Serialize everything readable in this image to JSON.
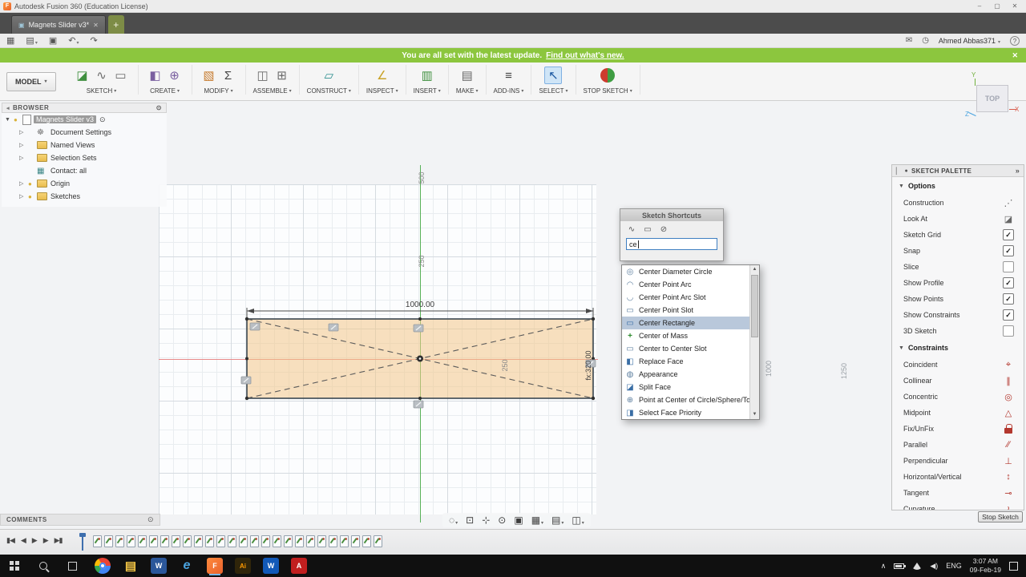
{
  "colors": {
    "banner_green": "#8cc63e",
    "highlight_blue": "#b9c8db",
    "sketch_fill": "#f2c789",
    "axis_green": "#58b158",
    "axis_red": "#e98a8a",
    "fusion_orange": "#e8622d"
  },
  "titlebar": {
    "app_badge": "F",
    "title": "Autodesk Fusion 360 (Education License)",
    "minimize": "–",
    "maximize": "▢",
    "close": "✕"
  },
  "tabs": {
    "icon": "▣",
    "active_label": "Magnets Slider v3*",
    "active_close": "✕",
    "new_tab": "+"
  },
  "quickbar": {
    "icons": [
      {
        "name": "app-launcher-icon",
        "glyph": "▦",
        "caret": ""
      },
      {
        "name": "file-menu-icon",
        "glyph": "▤",
        "caret": "▾"
      },
      {
        "name": "save-icon",
        "glyph": "▣",
        "caret": ""
      },
      {
        "name": "undo-icon",
        "glyph": "↶",
        "caret": "▾"
      },
      {
        "name": "redo-icon",
        "glyph": "↷",
        "caret": ""
      }
    ],
    "comment_icon": "✉",
    "history_icon": "◷",
    "user_name": "Ahmed Abbas371",
    "user_caret": "▾",
    "help": "?"
  },
  "banner": {
    "message": "You are all set with the latest update.",
    "link": "Find out what's new.",
    "close": "✕"
  },
  "ribbon": {
    "workspace": "MODEL",
    "caret": "▾",
    "groups": [
      {
        "label": "SKETCH",
        "icons": [
          {
            "name": "create-sketch-icon",
            "glyph": "◪",
            "cls": "ic-green"
          },
          {
            "name": "spline-icon",
            "glyph": "∿",
            "cls": "ic-gray"
          },
          {
            "name": "sketch-rectangle-icon",
            "glyph": "▭",
            "cls": "ic-gray"
          }
        ]
      },
      {
        "label": "CREATE",
        "icons": [
          {
            "name": "create-form-icon",
            "glyph": "◧",
            "cls": "ic-purple"
          },
          {
            "name": "create-primitive-icon",
            "glyph": "⊕",
            "cls": "ic-purple"
          }
        ]
      },
      {
        "label": "MODIFY",
        "icons": [
          {
            "name": "press-pull-icon",
            "glyph": "▧",
            "cls": "ic-orange"
          },
          {
            "name": "change-parameters-icon",
            "glyph": "Σ",
            "cls": "ic-dark"
          }
        ]
      },
      {
        "label": "ASSEMBLE",
        "icons": [
          {
            "name": "new-component-icon",
            "glyph": "◫",
            "cls": "ic-gray"
          },
          {
            "name": "joint-icon",
            "glyph": "⊞",
            "cls": "ic-gray"
          }
        ]
      },
      {
        "label": "CONSTRUCT",
        "icons": [
          {
            "name": "construction-plane-icon",
            "glyph": "▱",
            "cls": "ic-teal"
          }
        ]
      },
      {
        "label": "INSPECT",
        "icons": [
          {
            "name": "measure-icon",
            "glyph": "∠",
            "cls": "ic-yellow"
          }
        ]
      },
      {
        "label": "INSERT",
        "icons": [
          {
            "name": "insert-icon",
            "glyph": "▥",
            "cls": "ic-green"
          }
        ]
      },
      {
        "label": "MAKE",
        "icons": [
          {
            "name": "make-icon",
            "glyph": "▤",
            "cls": "ic-gray"
          }
        ]
      },
      {
        "label": "ADD-INS",
        "icons": [
          {
            "name": "add-ins-icon",
            "glyph": "≡",
            "cls": "ic-dark"
          }
        ]
      },
      {
        "label": "SELECT",
        "active": true,
        "icons": [
          {
            "name": "select-icon",
            "glyph": "↖",
            "cls": "ic-select"
          }
        ]
      },
      {
        "label": "STOP SKETCH",
        "icons": [
          {
            "name": "stop-sketch-icon",
            "glyph": "●",
            "cls": "ic-stop"
          }
        ]
      }
    ]
  },
  "viewcube": {
    "face": "TOP",
    "axis_x": "X",
    "axis_y": "Y",
    "axis_z": "Z"
  },
  "browser": {
    "title": "BROWSER",
    "collapse_icon": "◂",
    "panel_icon": "⊙",
    "rows": [
      {
        "arrow": "▼",
        "bulb": "●",
        "icon": "doc",
        "label": "Magnets Slider v3",
        "selected": true,
        "extra": "⊙",
        "child": false
      },
      {
        "arrow": "▷",
        "bulb": "",
        "icon": "gear",
        "label": "Document Settings",
        "child": true,
        "extra": ""
      },
      {
        "arrow": "▷",
        "bulb": "",
        "icon": "folder",
        "label": "Named Views",
        "child": true,
        "extra": ""
      },
      {
        "arrow": "▷",
        "bulb": "",
        "icon": "folder",
        "label": "Selection Sets",
        "child": true,
        "extra": ""
      },
      {
        "arrow": "",
        "bulb": "",
        "icon": "grid",
        "label": "Contact: all",
        "child": true,
        "extra": ""
      },
      {
        "arrow": "▷",
        "bulb": "●",
        "icon": "folder",
        "label": "Origin",
        "child": true,
        "extra": ""
      },
      {
        "arrow": "▷",
        "bulb": "●",
        "icon": "folder",
        "label": "Sketches",
        "child": true,
        "extra": ""
      }
    ]
  },
  "canvas": {
    "dim_width": "1000.00",
    "label_500": "500",
    "label_250": "250",
    "label_inner_250": "250",
    "label_height": "fx:320.00",
    "label_1000": "1000",
    "label_1250": "1250"
  },
  "shortcuts": {
    "title": "Sketch Shortcuts",
    "tools": [
      {
        "name": "spline-tool-icon",
        "glyph": "∿"
      },
      {
        "name": "rectangle-tool-icon",
        "glyph": "▭"
      },
      {
        "name": "circle-tool-icon",
        "glyph": "⊘"
      }
    ],
    "query": "ce",
    "scroll_up": "▲",
    "scroll_down": "▼",
    "items": [
      {
        "label": "Center Diameter Circle",
        "glyph": "◎",
        "cls": ""
      },
      {
        "label": "Center Point Arc",
        "glyph": "◠",
        "cls": ""
      },
      {
        "label": "Center Point Arc Slot",
        "glyph": "◡",
        "cls": ""
      },
      {
        "label": "Center Point Slot",
        "glyph": "▭",
        "cls": ""
      },
      {
        "label": "Center Rectangle",
        "glyph": "▭",
        "cls": "blue",
        "selected": true
      },
      {
        "label": "Center of Mass",
        "glyph": "+",
        "cls": "green"
      },
      {
        "label": "Center to Center Slot",
        "glyph": "▭",
        "cls": ""
      },
      {
        "label": "Replace Face",
        "glyph": "◧",
        "cls": "blue"
      },
      {
        "label": "Appearance",
        "glyph": "◍",
        "cls": ""
      },
      {
        "label": "Split Face",
        "glyph": "◪",
        "cls": "blue"
      },
      {
        "label": "Point at Center of Circle/Sphere/Torus",
        "glyph": "⊕",
        "cls": ""
      },
      {
        "label": "Select Face Priority",
        "glyph": "◨",
        "cls": "blue"
      }
    ]
  },
  "palette": {
    "grip": "▏",
    "dot": "●",
    "title": "SKETCH PALETTE",
    "expand": "»",
    "caret": "▼",
    "options_header": "Options",
    "options": [
      {
        "label": "Construction",
        "k": "opt-icon",
        "glyph": "⋰"
      },
      {
        "label": "Look At",
        "k": "opt-icon",
        "glyph": "◪"
      },
      {
        "label": "Sketch Grid",
        "k": "on",
        "glyph": "✓"
      },
      {
        "label": "Snap",
        "k": "on",
        "glyph": "✓"
      },
      {
        "label": "Slice",
        "k": "off",
        "glyph": ""
      },
      {
        "label": "Show Profile",
        "k": "on",
        "glyph": "✓"
      },
      {
        "label": "Show Points",
        "k": "on",
        "glyph": "✓"
      },
      {
        "label": "Show Constraints",
        "k": "on",
        "glyph": "✓"
      },
      {
        "label": "3D Sketch",
        "k": "off",
        "glyph": ""
      }
    ],
    "constraints_header": "Constraints",
    "constraints": [
      {
        "label": "Coincident",
        "k": "con-icon",
        "glyph": "⌖"
      },
      {
        "label": "Collinear",
        "k": "con-icon",
        "glyph": "∥"
      },
      {
        "label": "Concentric",
        "k": "con-icon",
        "glyph": "◎"
      },
      {
        "label": "Midpoint",
        "k": "con-icon",
        "glyph": "△"
      },
      {
        "label": "Fix/UnFix",
        "k": "lock",
        "glyph": ""
      },
      {
        "label": "Parallel",
        "k": "con-icon",
        "glyph": "∕∕"
      },
      {
        "label": "Perpendicular",
        "k": "con-icon",
        "glyph": "⊥"
      },
      {
        "label": "Horizontal/Vertical",
        "k": "con-icon",
        "glyph": "↕"
      },
      {
        "label": "Tangent",
        "k": "con-icon",
        "glyph": "⊸"
      },
      {
        "label": "Curvature",
        "k": "con-icon",
        "glyph": "≀"
      }
    ],
    "stop_button": "Stop Sketch"
  },
  "comments": {
    "label": "COMMENTS",
    "icon": "⊙"
  },
  "navbar": {
    "items": [
      {
        "name": "orbit-icon",
        "glyph": "◌",
        "caret": "▾"
      },
      {
        "name": "look-at-icon",
        "glyph": "⊡",
        "caret": ""
      },
      {
        "name": "pan-icon",
        "glyph": "⊹",
        "caret": ""
      },
      {
        "name": "zoom-icon",
        "glyph": "⊙",
        "caret": ""
      },
      {
        "name": "fit-icon",
        "glyph": "▣",
        "caret": ""
      },
      {
        "name": "display-settings-icon",
        "glyph": "▦",
        "caret": "▾"
      },
      {
        "name": "grid-layout-icon",
        "glyph": "▤",
        "caret": "▾"
      },
      {
        "name": "viewports-icon",
        "glyph": "◫",
        "caret": "▾"
      }
    ]
  },
  "timeline": {
    "controls": [
      {
        "name": "go-to-start-button",
        "glyph": "▮◀"
      },
      {
        "name": "step-back-button",
        "glyph": "◀"
      },
      {
        "name": "play-button",
        "glyph": "▶"
      },
      {
        "name": "step-forward-button",
        "glyph": "▶"
      },
      {
        "name": "go-to-end-button",
        "glyph": "▶▮"
      }
    ],
    "features": [
      "sk",
      "sk",
      "sk",
      "sk",
      "sk",
      "sk",
      "sk",
      "sk",
      "sk",
      "sk",
      "sk",
      "sk",
      "sk",
      "sk",
      "sk",
      "sk",
      "sk",
      "sk",
      "sk",
      "sk",
      "sk",
      "sk",
      "sk",
      "sk",
      "sk",
      "sk"
    ]
  },
  "taskbar": {
    "apps": [
      {
        "name": "chrome-icon",
        "k": "chrome",
        "text": ""
      },
      {
        "name": "file-explorer-icon",
        "k": "explorer",
        "text": "▤"
      },
      {
        "name": "word-icon",
        "k": "word",
        "text": "W"
      },
      {
        "name": "edge-icon",
        "k": "edge",
        "text": "e"
      },
      {
        "name": "fusion-360-icon",
        "k": "fusion",
        "text": "F",
        "active": true
      },
      {
        "name": "illustrator-icon",
        "k": "ai",
        "text": "Ai"
      },
      {
        "name": "word-2-icon",
        "k": "word2",
        "text": "W"
      },
      {
        "name": "acrobat-icon",
        "k": "acrobat",
        "text": "A"
      }
    ],
    "tray": {
      "chevron": "∧",
      "volume": "◀)",
      "lang": "ENG",
      "time": "3:07 AM",
      "date": "09-Feb-19"
    }
  }
}
